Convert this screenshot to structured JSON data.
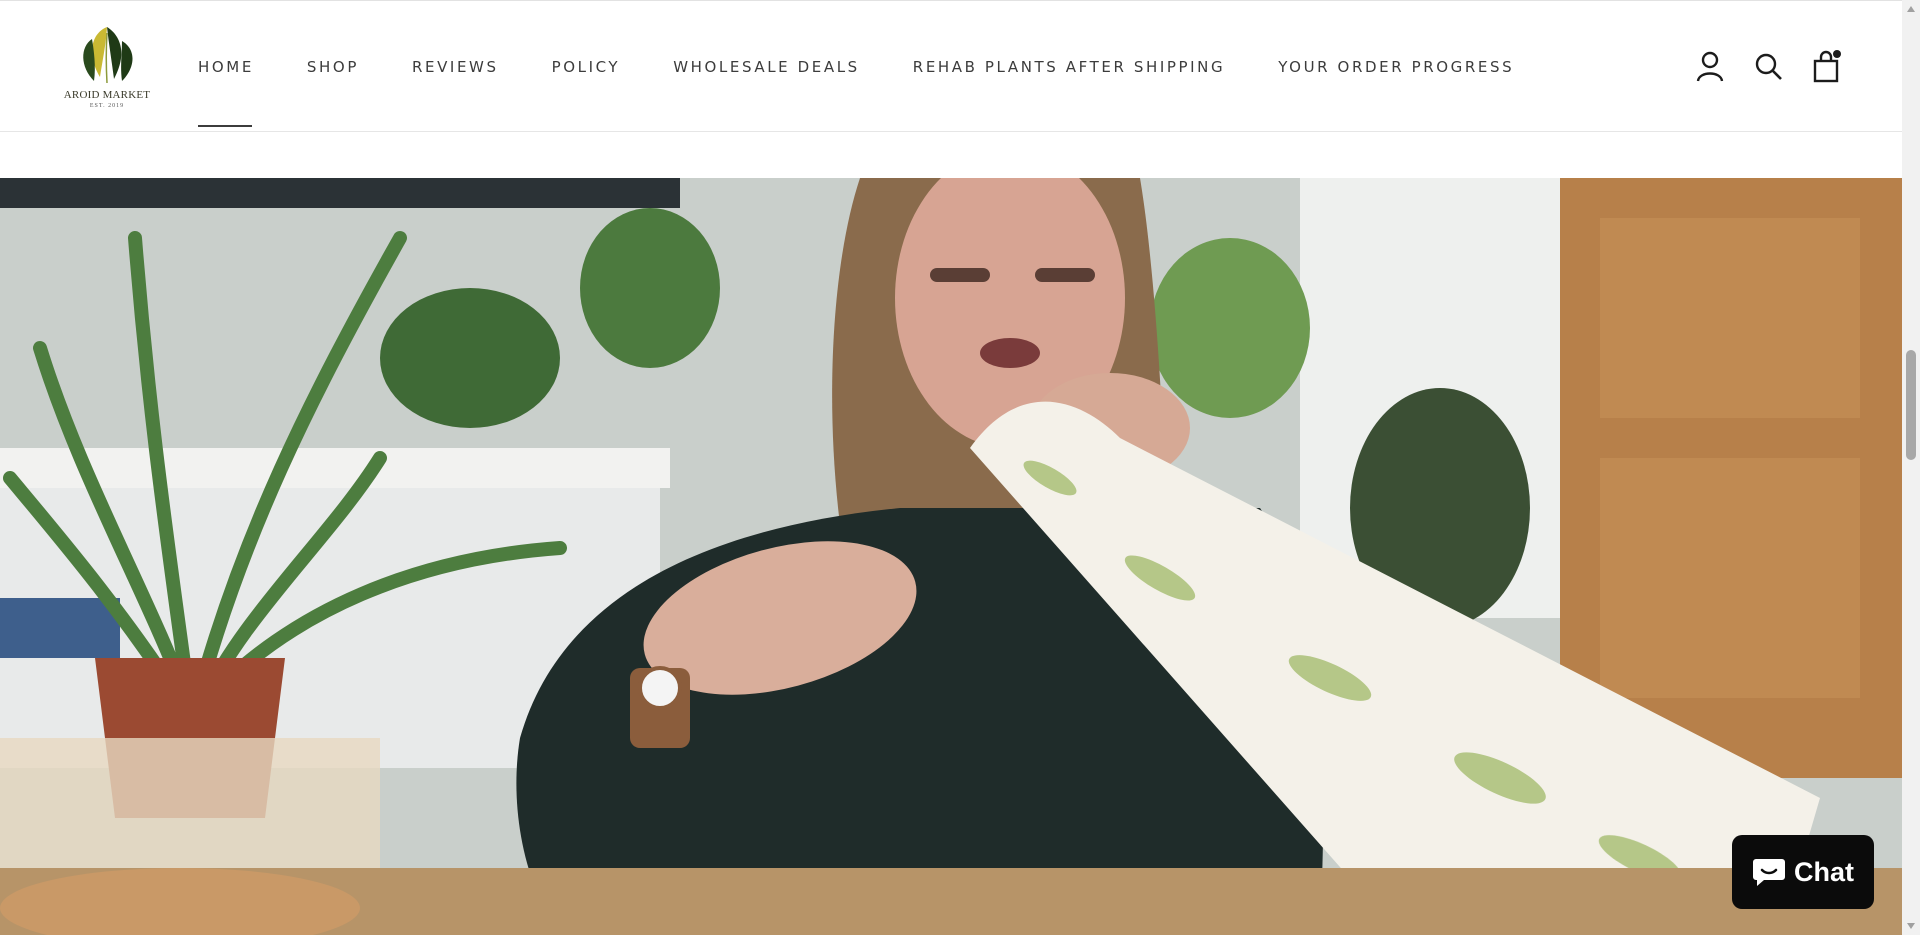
{
  "brand": {
    "name": "AROID MARKET",
    "est": "EST. 2019"
  },
  "nav": {
    "items": [
      {
        "label": "HOME",
        "active": true
      },
      {
        "label": "SHOP"
      },
      {
        "label": "REVIEWS"
      },
      {
        "label": "POLICY"
      },
      {
        "label": "WHOLESALE DEALS"
      },
      {
        "label": "REHAB PLANTS AFTER SHIPPING"
      },
      {
        "label": "YOUR ORDER PROGRESS"
      }
    ]
  },
  "header_icons": [
    "account-icon",
    "search-icon",
    "cart-icon"
  ],
  "chat": {
    "label": "Chat"
  },
  "colors": {
    "text": "#3c3c3c",
    "chat_bg": "#0b0b0b",
    "leaf_dark": "#1f3a16",
    "leaf_yellow": "#c9b933"
  }
}
